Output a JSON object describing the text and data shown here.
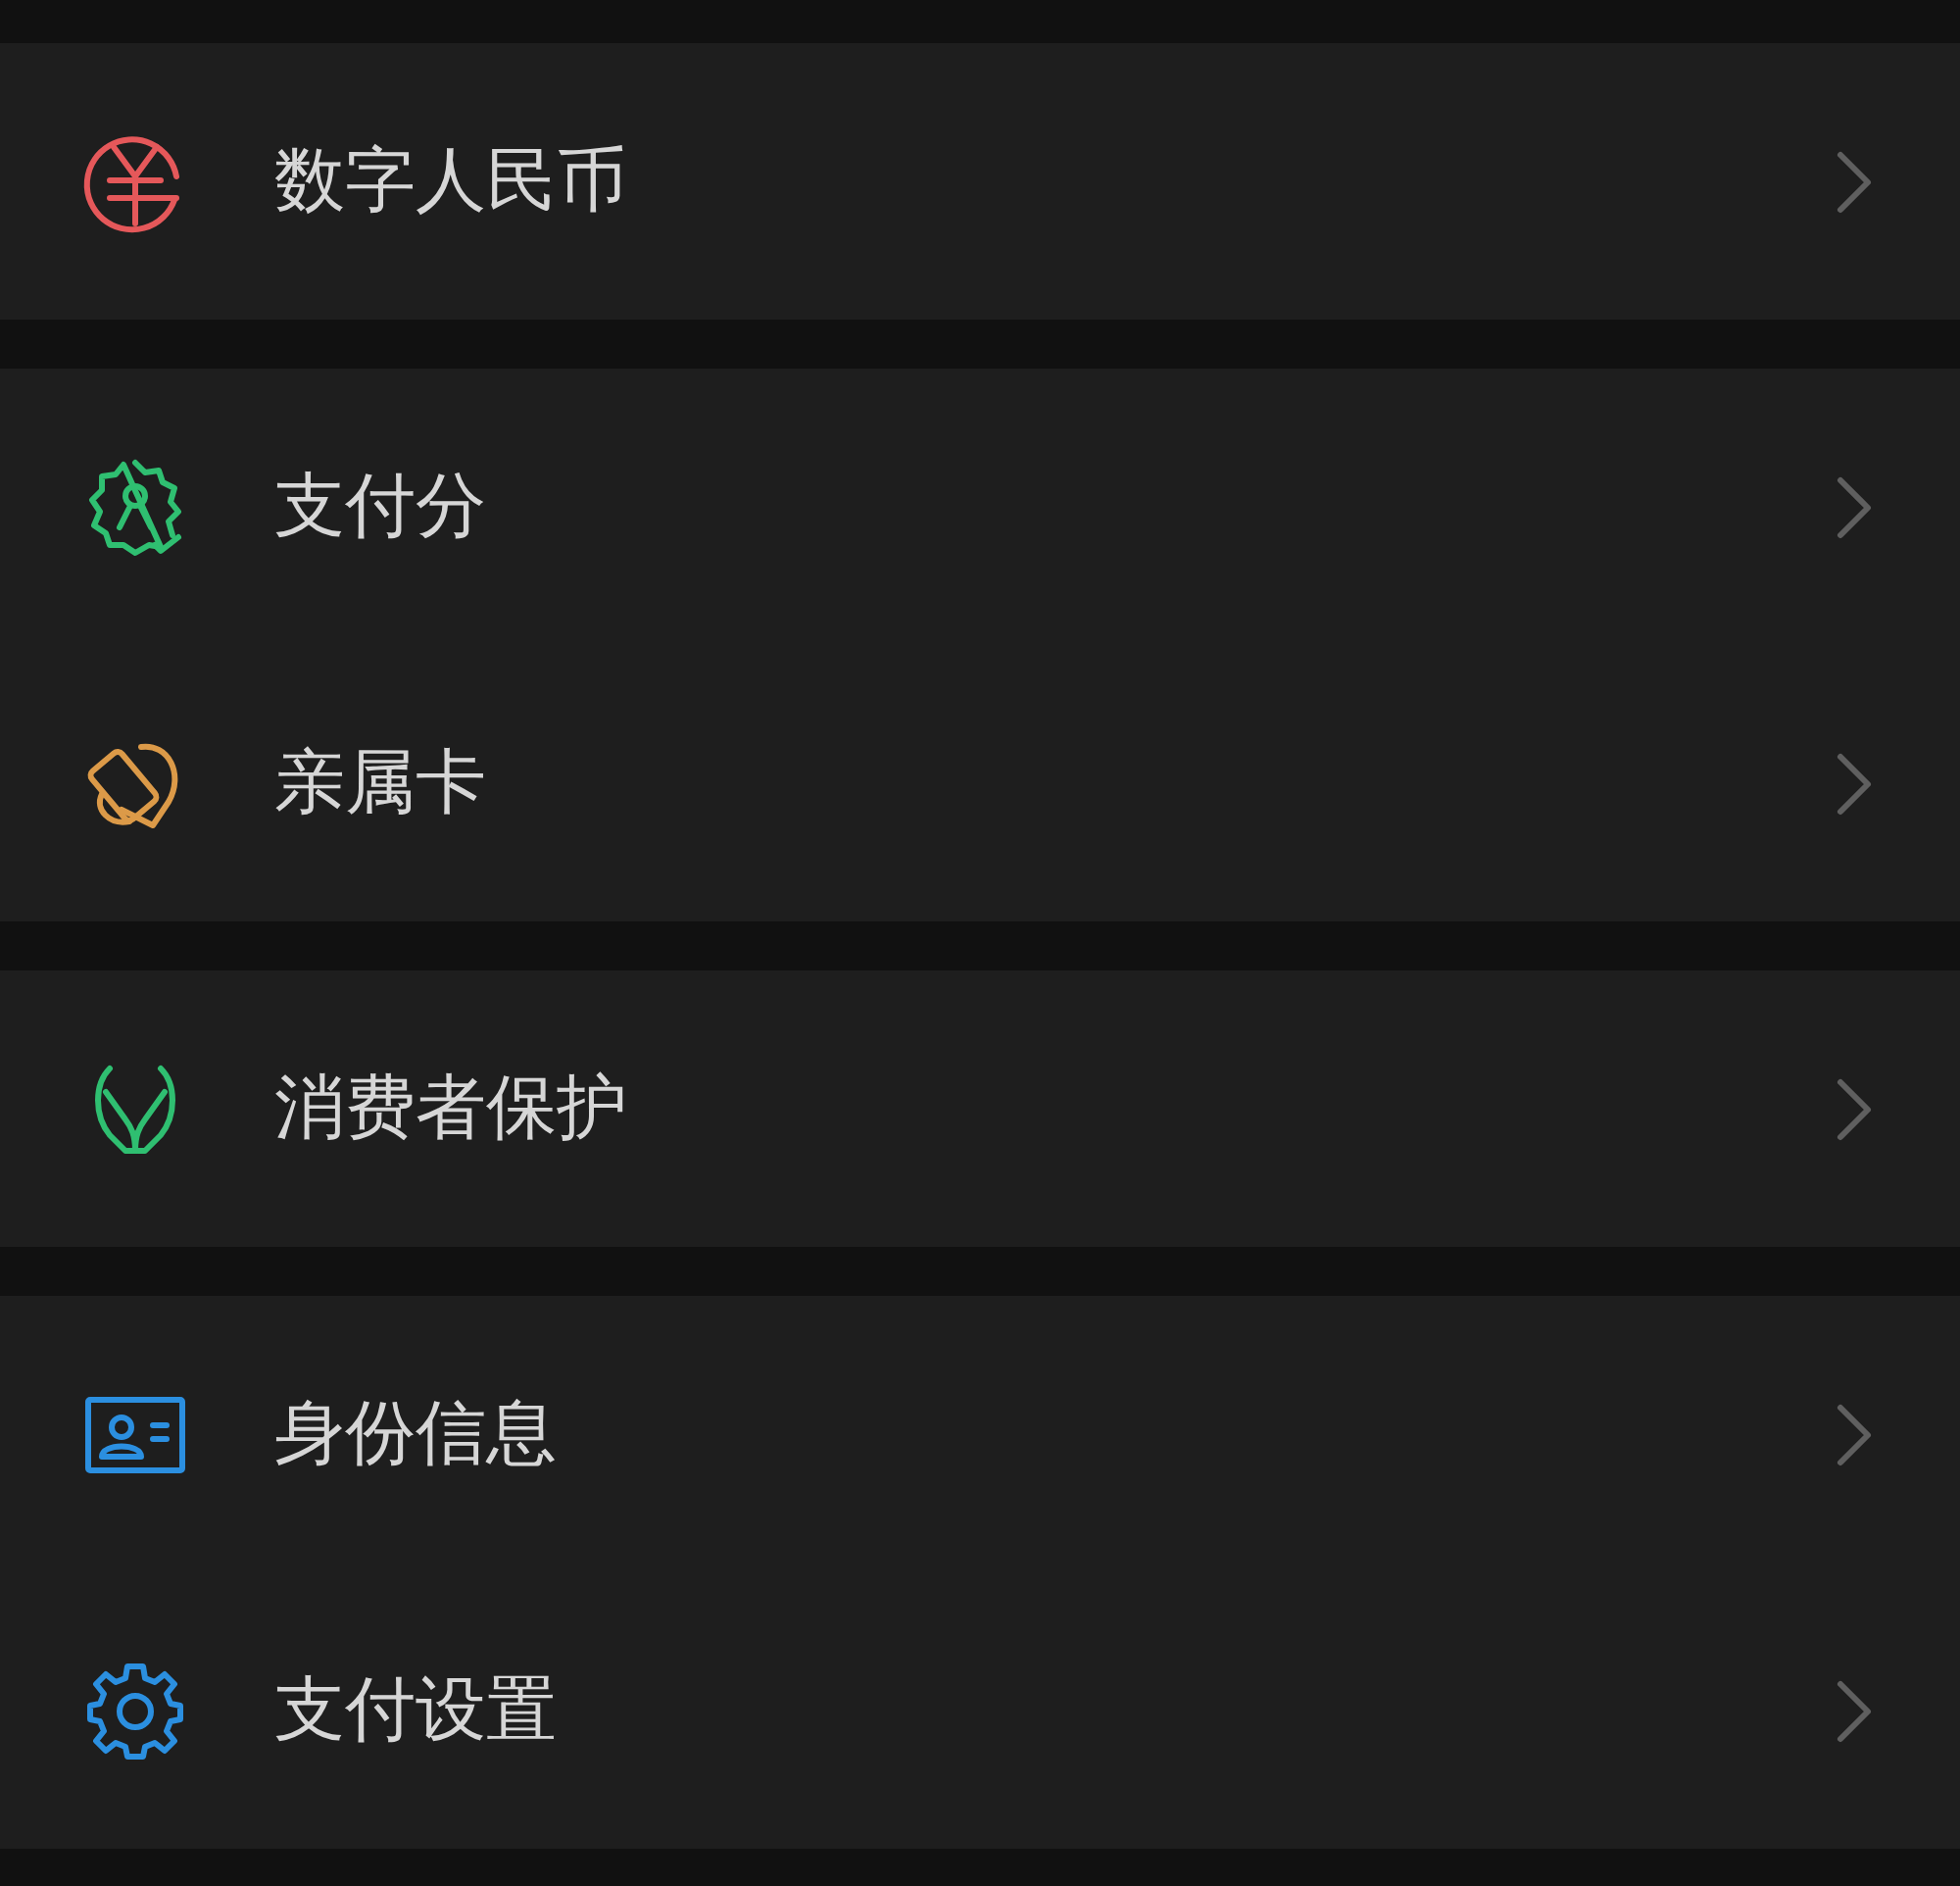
{
  "groups": [
    {
      "items": [
        {
          "label": "数字人民币",
          "kind": "yuan",
          "color": "#e5585a"
        }
      ]
    },
    {
      "items": [
        {
          "label": "支付分",
          "kind": "score",
          "color": "#2fbf71"
        },
        {
          "label": "亲属卡",
          "kind": "family-card",
          "color": "#dc9a48"
        }
      ]
    },
    {
      "items": [
        {
          "label": "消费者保护",
          "kind": "protect",
          "color": "#2fbf71"
        }
      ]
    },
    {
      "items": [
        {
          "label": "身份信息",
          "kind": "id-card",
          "color": "#2b8fe0"
        },
        {
          "label": "支付设置",
          "kind": "settings",
          "color": "#2b8fe0"
        }
      ]
    }
  ]
}
